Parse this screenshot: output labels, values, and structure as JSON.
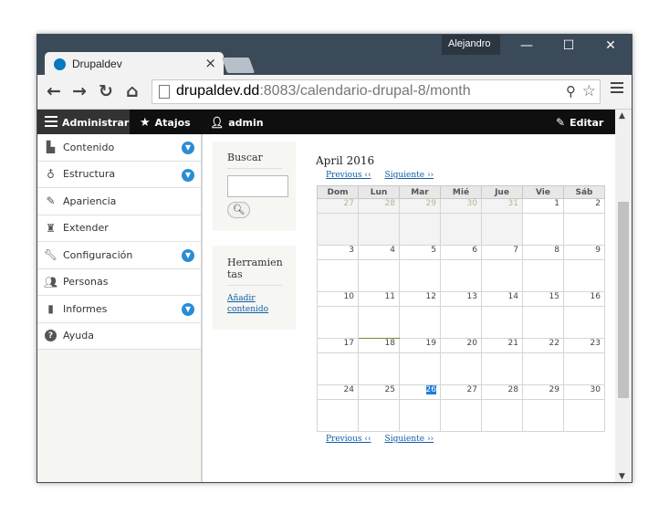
{
  "browser": {
    "tab_title": "Drupaldev",
    "tab_close": "×",
    "user": "Alejandro",
    "minimize": "—",
    "maximize": "☐",
    "close": "✕",
    "url_host": "drupaldev.dd",
    "url_rest": ":8083/calendario-drupal-8/month",
    "icons": [
      "back-arrow-icon",
      "forward-arrow-icon",
      "reload-icon",
      "home-icon",
      "page-icon",
      "zoom-icon",
      "star-icon",
      "menu-icon"
    ]
  },
  "admin_bar": {
    "manage": "Administrar",
    "shortcuts": "Atajos",
    "user": "admin",
    "edit": "Editar"
  },
  "sidebar": {
    "items": [
      {
        "label": "Contenido",
        "icon": "file-icon",
        "expandable": true
      },
      {
        "label": "Estructura",
        "icon": "sitemap-icon",
        "expandable": true
      },
      {
        "label": "Apariencia",
        "icon": "brush-icon",
        "expandable": false
      },
      {
        "label": "Extender",
        "icon": "puzzle-icon",
        "expandable": false
      },
      {
        "label": "Configuración",
        "icon": "wrench-icon",
        "expandable": true
      },
      {
        "label": "Personas",
        "icon": "people-icon",
        "expandable": false
      },
      {
        "label": "Informes",
        "icon": "bars-icon",
        "expandable": true
      },
      {
        "label": "Ayuda",
        "icon": "help-icon",
        "expandable": false
      }
    ]
  },
  "search_block": {
    "title": "Buscar",
    "button_icon": "search-icon"
  },
  "tools_block": {
    "title": "Herramien tas",
    "link": "Añadir contenido"
  },
  "calendar": {
    "title": "April 2016",
    "prev": "Previous ‹‹",
    "next": "Siguiente ››",
    "weekdays": [
      "Dom",
      "Lun",
      "Mar",
      "Mié",
      "Jue",
      "Vie",
      "Sáb"
    ],
    "weeks": [
      [
        "27",
        "28",
        "29",
        "30",
        "31",
        "1",
        "2"
      ],
      [
        "3",
        "4",
        "5",
        "6",
        "7",
        "8",
        "9"
      ],
      [
        "10",
        "11",
        "12",
        "13",
        "14",
        "15",
        "16"
      ],
      [
        "17",
        "18",
        "19",
        "20",
        "21",
        "22",
        "23"
      ],
      [
        "24",
        "25",
        "26",
        "27",
        "28",
        "29",
        "30"
      ]
    ],
    "prev_month_days_in_first_week": 5,
    "today": "26"
  }
}
